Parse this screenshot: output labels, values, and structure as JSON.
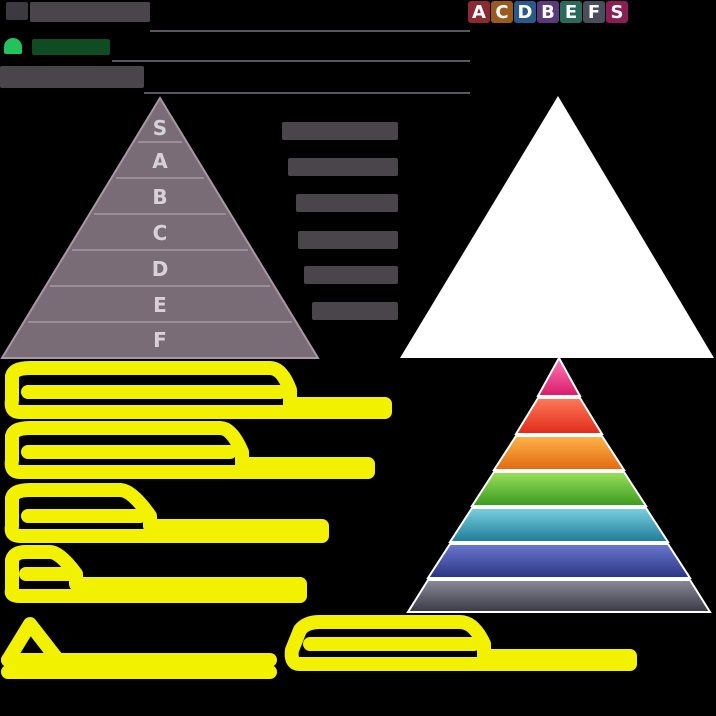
{
  "header": {
    "brand_text": "",
    "green_label": "",
    "subtitle": ""
  },
  "tier_badges": {
    "letters": [
      "A",
      "C",
      "D",
      "B",
      "E",
      "F",
      "S"
    ],
    "colors": [
      "#c0392b",
      "#e67e22",
      "#2e86c1",
      "#8e44ad",
      "#16a085",
      "#5d6d7e",
      "#c2185b"
    ]
  },
  "left_pyramid": {
    "tiers": [
      "S",
      "A",
      "B",
      "C",
      "D",
      "E",
      "F"
    ],
    "fill": "#7a6c76",
    "line": "#a898a6"
  },
  "right_triangle": {
    "fill": "#ffffff"
  },
  "rainbow_pyramid": {
    "bands": [
      "#f03c8a",
      "#f24a2c",
      "#f68c1f",
      "#5fc236",
      "#3aa6bd",
      "#3f4a9c",
      "#5b5b68"
    ]
  },
  "scribble_color": "#f2f200"
}
